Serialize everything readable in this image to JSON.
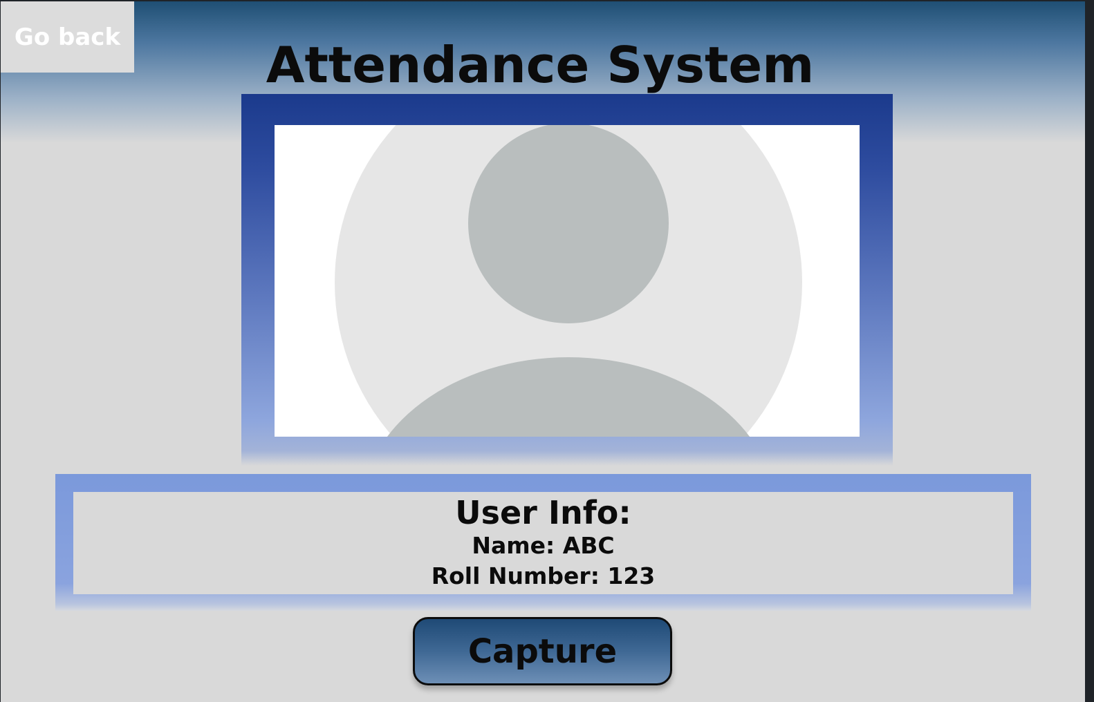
{
  "header": {
    "back_label": "Go back",
    "title": "Attendance System"
  },
  "camera": {
    "placeholder_icon": "user-avatar-placeholder-icon"
  },
  "user_info": {
    "heading": "User Info:",
    "name_line": "Name: ABC",
    "roll_line": "Roll Number: 123"
  },
  "actions": {
    "capture_label": "Capture"
  },
  "colors": {
    "frame_top": "#1b3a8c",
    "frame_bottom": "#8ea6dd",
    "info_border": "#7b99db",
    "button_top": "#1f4a76",
    "button_bottom": "#6d8fb6",
    "placeholder_bg": "#e6e6e6",
    "placeholder_figure": "#b9bebe"
  }
}
